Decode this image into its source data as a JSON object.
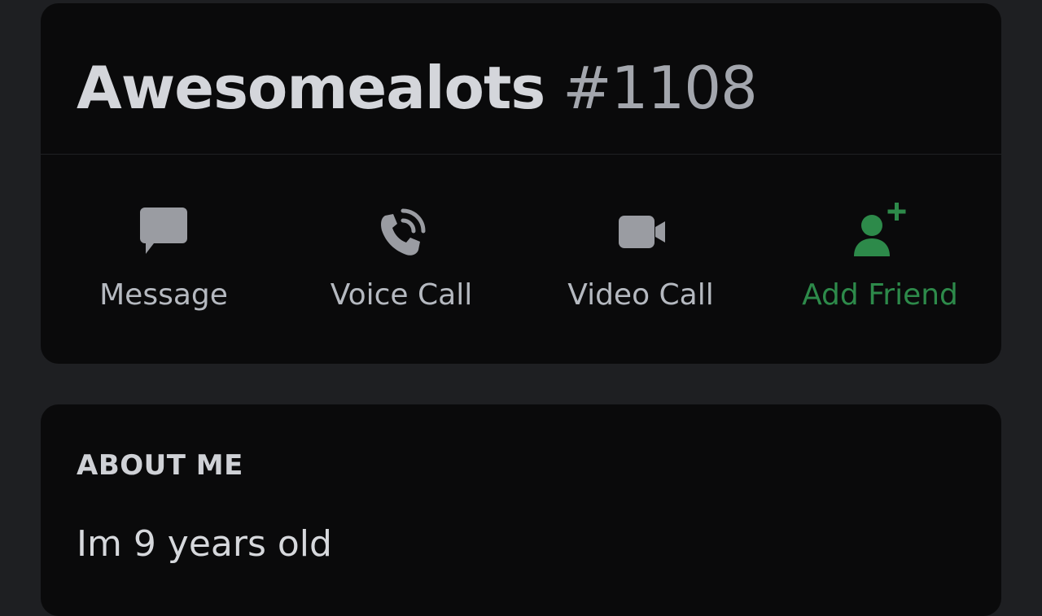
{
  "profile": {
    "username": "Awesomealots",
    "discriminator": "#1108"
  },
  "actions": [
    {
      "label": "Message",
      "icon": "message-icon"
    },
    {
      "label": "Voice Call",
      "icon": "phone-icon"
    },
    {
      "label": "Video Call",
      "icon": "video-camera-icon"
    },
    {
      "label": "Add Friend",
      "icon": "add-friend-icon"
    }
  ],
  "about": {
    "heading": "ABOUT ME",
    "text": "Im 9 years old"
  },
  "colors": {
    "background": "#1e1f22",
    "card": "#0a0a0b",
    "icon_gray": "#9a9ca2",
    "accent_green": "#2d8a4a"
  }
}
